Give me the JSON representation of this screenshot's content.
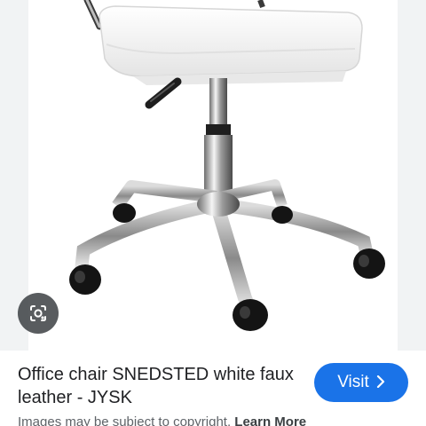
{
  "product": {
    "image_subject": "white faux leather office chair with chrome five-star base",
    "title": "Office chair SNEDSTED white faux leather - JYSK"
  },
  "actions": {
    "visit_label": "Visit",
    "visit_icon": "chevron-right-icon",
    "lens_icon": "google-lens-icon"
  },
  "footer": {
    "copyright_text": "Images may be subject to copyright.",
    "learn_more_label": "Learn More"
  },
  "colors": {
    "accent": "#1a73e8",
    "page_background": "#f1f3f4",
    "title_text": "#202124",
    "muted_text": "#5f6368"
  }
}
